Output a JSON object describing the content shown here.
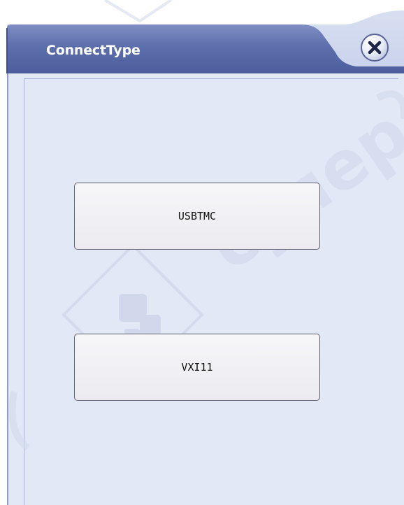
{
  "window": {
    "title": "ConnectType",
    "close_label": "close"
  },
  "buttons": {
    "usbtmc_label": "USBTMC",
    "vxi11_label": "VXI11"
  },
  "watermark": {
    "text": "супер"
  },
  "colors": {
    "titlebar": "#5f70ac",
    "dialog_bg": "#e3e8f6",
    "button_border": "#5f6270",
    "watermark": "#d1d8ea"
  },
  "icons": {
    "close": "close-x-icon",
    "watermark_logo": "gear-logo-icon"
  }
}
